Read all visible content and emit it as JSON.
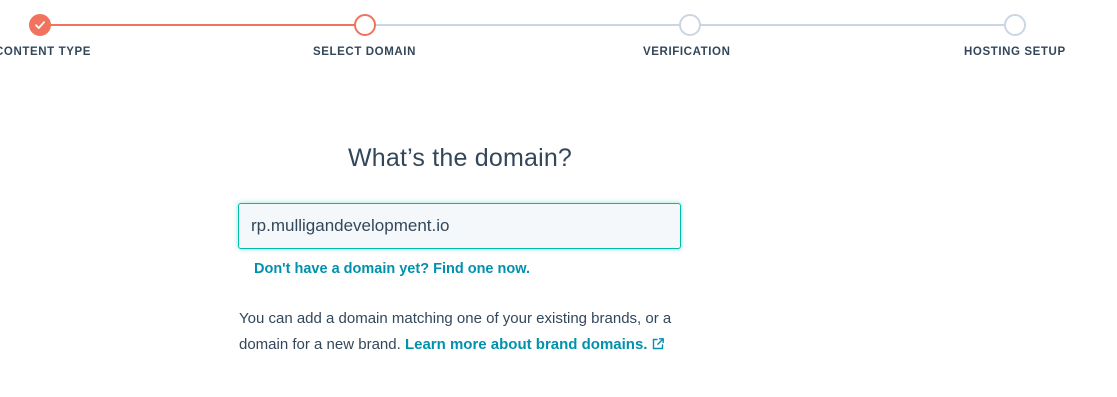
{
  "stepper": {
    "steps": [
      {
        "label": "CONTENT TYPE",
        "state": "completed"
      },
      {
        "label": "SELECT DOMAIN",
        "state": "current"
      },
      {
        "label": "VERIFICATION",
        "state": "upcoming"
      },
      {
        "label": "HOSTING SETUP",
        "state": "upcoming"
      }
    ]
  },
  "main": {
    "question": "What’s the domain?",
    "domain_input": {
      "value": "rp.mulligandevelopment.io"
    },
    "find_domain_link": "Don't have a domain yet? Find one now.",
    "help_text": "You can add a domain matching one of your existing brands, or a domain for a new brand.",
    "learn_more_link": "Learn more about brand domains."
  },
  "icons": {
    "completed_step": "checkmark-icon",
    "learn_more": "external-link-icon"
  },
  "colors": {
    "accent": "#f2735d",
    "inactive": "#cbd6e2",
    "link": "#0091ae",
    "focus": "#00bda5",
    "text": "#33475b"
  }
}
